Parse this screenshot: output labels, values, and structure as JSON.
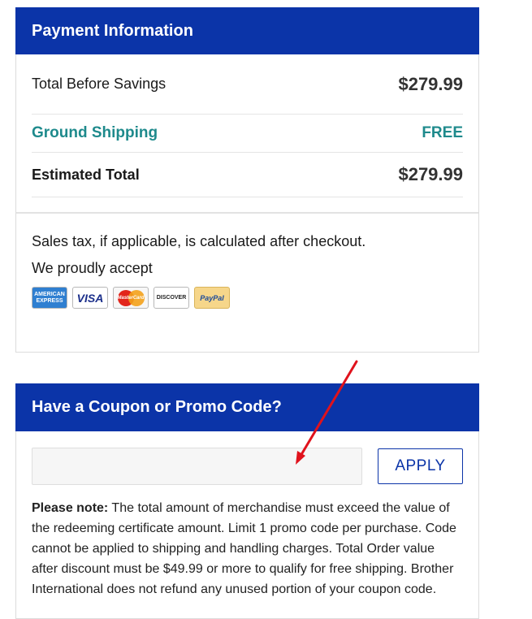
{
  "payment": {
    "title": "Payment Information",
    "rows": [
      {
        "label": "Total Before Savings",
        "value": "$279.99"
      },
      {
        "label": "Ground Shipping",
        "value": "FREE"
      },
      {
        "label": "Estimated Total",
        "value": "$279.99"
      }
    ],
    "tax_note": "Sales tax, if applicable, is calculated after checkout.",
    "accept_label": "We proudly accept",
    "cards": [
      {
        "name": "American Express",
        "text": "AMERICAN EXPRESS"
      },
      {
        "name": "Visa",
        "text": "VISA"
      },
      {
        "name": "MasterCard",
        "text": "MasterCard"
      },
      {
        "name": "Discover",
        "text": "DISCOVER"
      },
      {
        "name": "PayPal",
        "text": "PayPal"
      }
    ]
  },
  "coupon": {
    "title": "Have a Coupon or Promo Code?",
    "input_value": "",
    "apply_label": "APPLY",
    "note_bold": "Please note:",
    "note_text": " The total amount of merchandise must exceed the value of the redeeming certificate amount. Limit 1 promo code per purchase. Code cannot be applied to shipping and handling charges. Total Order value after discount must be $49.99 or more to qualify for free shipping. Brother International does not refund any unused portion of your coupon code."
  },
  "colors": {
    "header_bg": "#0b34a8",
    "shipping": "#1e8a8c",
    "annotation_arrow": "#e0121c"
  }
}
